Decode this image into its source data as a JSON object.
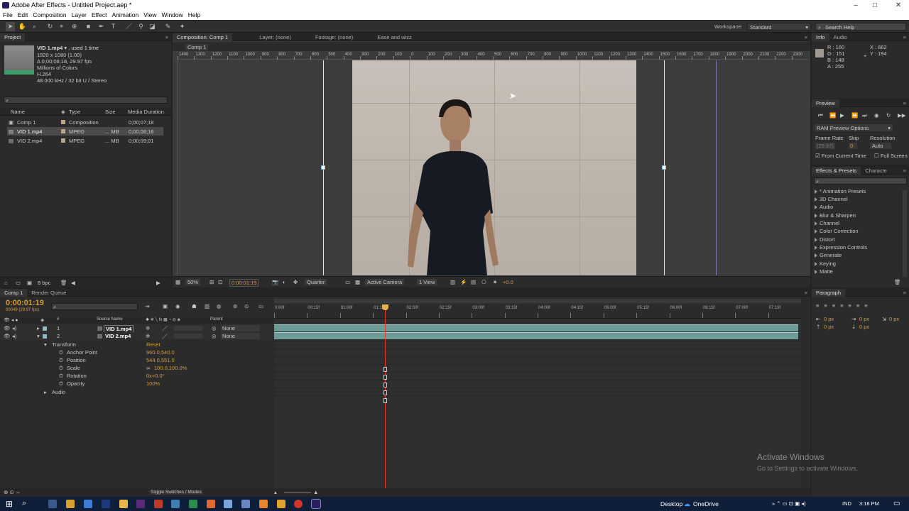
{
  "window": {
    "title": "Adobe After Effects - Untitled Project.aep *"
  },
  "menu": [
    "File",
    "Edit",
    "Composition",
    "Layer",
    "Effect",
    "Animation",
    "View",
    "Window",
    "Help"
  ],
  "toolbar": {
    "workspace_label": "Workspace:",
    "workspace_value": "Standard",
    "search_placeholder": "Search Help"
  },
  "project": {
    "tab": "Project",
    "preview": {
      "name": "VID 1.mp4",
      "used": ", used 1 time",
      "dims": "1920 x 1080 (1.00)",
      "duration": "Δ 0;00;08;18, 29.97 fps",
      "colors": "Millions of Colors",
      "codec": "H.264",
      "audio": "48.000 kHz / 32 bit U / Stereo"
    },
    "columns": [
      "Name",
      "Type",
      "Size",
      "Media Duration"
    ],
    "items": [
      {
        "name": "Comp 1",
        "type": "Composition",
        "size": "",
        "duration": "0;00;07;18",
        "color": "#b9a58a"
      },
      {
        "name": "VID 1.mp4",
        "type": "MPEG",
        "size": "... MB",
        "duration": "0;00;08;18",
        "color": "#b9a58a"
      },
      {
        "name": "VID 2.mp4",
        "type": "MPEG",
        "size": "... MB",
        "duration": "0;00;09;01",
        "color": "#b9a58a"
      }
    ],
    "bpc": "8 bpc"
  },
  "viewer": {
    "tabs": [
      "Composition: Comp 1",
      "Layer: (none)",
      "Footage: (none)",
      "Ease and wizz"
    ],
    "breadcrumb": "Comp 1",
    "ruler_labels": [
      "1400",
      "1300",
      "1200",
      "1100",
      "1000",
      "900",
      "800",
      "700",
      "600",
      "500",
      "400",
      "300",
      "200",
      "100",
      "0",
      "100",
      "200",
      "300",
      "400",
      "500",
      "600",
      "700",
      "800",
      "900",
      "1000",
      "1100",
      "1200",
      "1300",
      "1400",
      "1500",
      "1600",
      "1700",
      "1800",
      "1900",
      "2000",
      "2100",
      "2200",
      "2300"
    ],
    "zoom": "50%",
    "timecode": "0:00:01:19",
    "resolution": "Quarter",
    "camera": "Active Camera",
    "views": "1 View",
    "exposure": "+0.0"
  },
  "info": {
    "tabs": [
      "Info",
      "Audio"
    ],
    "r": "R : 160",
    "g": "G : 151",
    "b": "B : 148",
    "a": "A : 255",
    "x": "X : 662",
    "y": "Y : 194"
  },
  "preview": {
    "tab": "Preview",
    "ram_options": "RAM Preview Options",
    "frame_rate_label": "Frame Rate",
    "skip_label": "Skip",
    "resolution_label": "Resolution",
    "frame_rate": "(29.97)",
    "skip": "0",
    "resolution": "Auto",
    "from_current": "From Current Time",
    "full_screen": "Full Screen"
  },
  "effects": {
    "tabs": [
      "Effects & Presets",
      "Characte"
    ],
    "items": [
      "* Animation Presets",
      "3D Channel",
      "Audio",
      "Blur & Sharpen",
      "Channel",
      "Color Correction",
      "Distort",
      "Expression Controls",
      "Generate",
      "Keying",
      "Matte"
    ]
  },
  "timeline": {
    "tabs": [
      "Comp 1",
      "Render Queue"
    ],
    "timecode": "0:00:01:19",
    "frames": "00049 (29.97 fps)",
    "col_source": "Source Name",
    "col_parent": "Parent",
    "time_labels": [
      "0:00f",
      "00:15f",
      "01:00f",
      "01:15f",
      "02:00f",
      "02:15f",
      "03:00f",
      "03:15f",
      "04:00f",
      "04:15f",
      "05:00f",
      "05:15f",
      "06:00f",
      "06:15f",
      "07:00f",
      "07:15f"
    ],
    "layers": [
      {
        "num": "1",
        "name": "VID 1.mp4",
        "parent": "None"
      },
      {
        "num": "2",
        "name": "VID 2.mp4",
        "parent": "None"
      }
    ],
    "transform": {
      "label": "Transform",
      "reset": "Reset",
      "props": [
        {
          "name": "Anchor Point",
          "value": "960.0,540.0"
        },
        {
          "name": "Position",
          "value": "544.0,551.0"
        },
        {
          "name": "Scale",
          "value": "100.0,100.0%"
        },
        {
          "name": "Rotation",
          "value": "0x+0.0°"
        },
        {
          "name": "Opacity",
          "value": "100%"
        }
      ]
    },
    "audio_label": "Audio",
    "toggle": "Toggle Switches / Modes",
    "playhead_fraction": 0.21
  },
  "paragraph": {
    "tab": "Paragraph",
    "px1": "0 px",
    "px2": "0 px",
    "px3": "0 px",
    "px4": "0 px",
    "px5": "0 px"
  },
  "watermark": {
    "line1": "Activate Windows",
    "line2": "Go to Settings to activate Windows."
  },
  "taskbar": {
    "desktop": "Desktop",
    "onedrive": "OneDrive",
    "lang": "IND",
    "time": "3:18 PM"
  }
}
